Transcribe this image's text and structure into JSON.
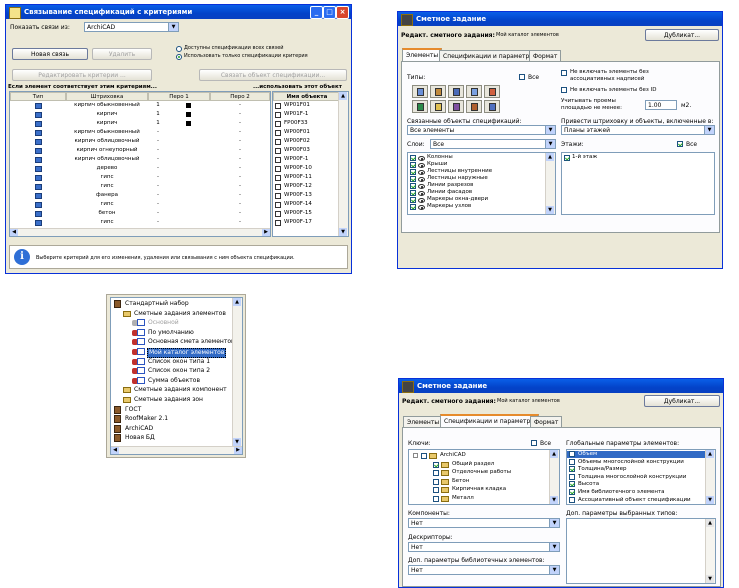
{
  "win1": {
    "title": "Связывание спецификаций с критериями",
    "link_label": "Показать связи из:",
    "link_value": "ArchiCAD",
    "new_link": "Новая связь",
    "delete": "Удалить",
    "radio1": "Доступны спецификации всех связей",
    "radio2": "Использовать только спецификации критерия",
    "edit_criteria": "Редактировать критерии ...",
    "link_object_spec": "Связать объект спецификации...",
    "left_header": "Если элемент соответствует этим критериям...",
    "right_header": "...использовать этот объект",
    "cols": [
      "Тип",
      "Штриховка",
      "Перо 1",
      "Перо 2"
    ],
    "right_col": "Имя объекта",
    "rows": [
      {
        "hatch": "кирпич обыкновенный",
        "pen1": "1",
        "pen2": "-",
        "obj": "WP01F01"
      },
      {
        "hatch": "кирпич",
        "pen1": "1",
        "pen2": "-",
        "obj": "WP01F-1"
      },
      {
        "hatch": "кирпич",
        "pen1": "1",
        "pen2": "-",
        "obj": "FP00F33"
      },
      {
        "hatch": "кирпич обыкновенный",
        "pen1": "-",
        "pen2": "-",
        "obj": "WP00F01"
      },
      {
        "hatch": "кирпич облицовочный",
        "pen1": "-",
        "pen2": "-",
        "obj": "WP00F02"
      },
      {
        "hatch": "кирпич огнеупорный",
        "pen1": "-",
        "pen2": "-",
        "obj": "WP00F03"
      },
      {
        "hatch": "кирпич облицовочный",
        "pen1": "-",
        "pen2": "-",
        "obj": "WP00F-1"
      },
      {
        "hatch": "дерево",
        "pen1": "-",
        "pen2": "-",
        "obj": "WP00F-10"
      },
      {
        "hatch": "гипс",
        "pen1": "-",
        "pen2": "-",
        "obj": "WP00F-11"
      },
      {
        "hatch": "гипс",
        "pen1": "-",
        "pen2": "-",
        "obj": "WP00F-12"
      },
      {
        "hatch": "фанера",
        "pen1": "-",
        "pen2": "-",
        "obj": "WP00F-13"
      },
      {
        "hatch": "гипс",
        "pen1": "-",
        "pen2": "-",
        "obj": "WP00F-14"
      },
      {
        "hatch": "бетон",
        "pen1": "-",
        "pen2": "-",
        "obj": "WP00F-15"
      },
      {
        "hatch": "гипс",
        "pen1": "-",
        "pen2": "-",
        "obj": "WP00F-17"
      }
    ],
    "info": "Выберите критерий для его изменения, удаления или связывания с ним объекта спецификации."
  },
  "win2": {
    "title": "Сметное задание",
    "edit_label": "Редакт. сметного задания:",
    "edit_value": "Мой каталог элементов",
    "duplicate": "Дубликат...",
    "tabs": [
      "Элементы",
      "Спецификации и параметры",
      "Формат"
    ],
    "types_label": "Типы:",
    "all1": "Все",
    "opt1": "Не включать элементы без ассоциативных надписей",
    "opt2": "Не включать элементы без ID",
    "openings_label": "Учитывать проемы площадью не менее:",
    "openings_value": "1.00",
    "openings_unit": "м2.",
    "linked_label": "Связанные объекты спецификаций:",
    "linked_value": "Все элементы",
    "hatch_label": "Привести штриховку и объекты, включенные в:",
    "hatch_value": "Планы этажей",
    "layers_label": "Слои:",
    "layers_value": "Все",
    "floors_label": "Этажи:",
    "all2": "Все",
    "layers": [
      "Колонны",
      "Крыши",
      "Лестницы внутренние",
      "Лестницы наружные",
      "Линии разрезов",
      "Линии фасадов",
      "Маркеры окна-двери",
      "Маркеры узлов"
    ],
    "floors": [
      "1-й этаж"
    ]
  },
  "win3": {
    "items": [
      {
        "label": "Стандартный набор",
        "level": 0
      },
      {
        "label": "Сметные задания элементов",
        "level": 1
      },
      {
        "label": "Основной",
        "level": 2,
        "grey": true
      },
      {
        "label": "По умолчанию",
        "level": 2
      },
      {
        "label": "Основная смета элементов",
        "level": 2
      },
      {
        "label": "Мой каталог элементов",
        "level": 2,
        "selected": true
      },
      {
        "label": "Список окон типа 1",
        "level": 2
      },
      {
        "label": "Список окон типа 2",
        "level": 2
      },
      {
        "label": "Сумма объектов",
        "level": 2
      },
      {
        "label": "Сметные задания компонент",
        "level": 1
      },
      {
        "label": "Сметные задания зон",
        "level": 1
      },
      {
        "label": "ГОСТ",
        "level": 0
      },
      {
        "label": "RoofMaker 2.1",
        "level": 0
      },
      {
        "label": "ArchiCAD",
        "level": 0
      },
      {
        "label": "Новая БД",
        "level": 0
      }
    ]
  },
  "win4": {
    "title": "Сметное задание",
    "edit_label": "Редакт. сметного задания:",
    "edit_value": "Мой каталог элементов",
    "duplicate": "Дубликат...",
    "tabs": [
      "Элементы",
      "Спецификации и параметры",
      "Формат"
    ],
    "keys_label": "Ключи:",
    "all": "Все",
    "global_label": "Глобальные параметры элементов:",
    "keys": [
      {
        "label": "ArchiCAD",
        "level": 0,
        "checked": false
      },
      {
        "label": "Общий раздел",
        "level": 1,
        "checked": true
      },
      {
        "label": "Отделочные работы",
        "level": 1,
        "checked": false
      },
      {
        "label": "Бетон",
        "level": 1,
        "checked": false
      },
      {
        "label": "Кирпичная кладка",
        "level": 1,
        "checked": false
      },
      {
        "label": "Металл",
        "level": 1,
        "checked": false
      }
    ],
    "params": [
      {
        "label": "Объем",
        "checked": false,
        "selected": true
      },
      {
        "label": "Объемы многослойной конструкции",
        "checked": false
      },
      {
        "label": "Толщина/Размер",
        "checked": true
      },
      {
        "label": "Толщина многослойной конструкции",
        "checked": false
      },
      {
        "label": "Высота",
        "checked": true
      },
      {
        "label": "Имя библиотечного элемента",
        "checked": true
      },
      {
        "label": "Ассоциативный объект спецификации",
        "checked": false
      }
    ],
    "components_label": "Компоненты:",
    "components_value": "Нет",
    "add_params_label": "Доп. параметры выбранных типов:",
    "descriptors_label": "Дескрипторы:",
    "descriptors_value": "Нет",
    "lib_params_label": "Доп. параметры библиотечных элементов:",
    "lib_params_value": "Нет"
  }
}
